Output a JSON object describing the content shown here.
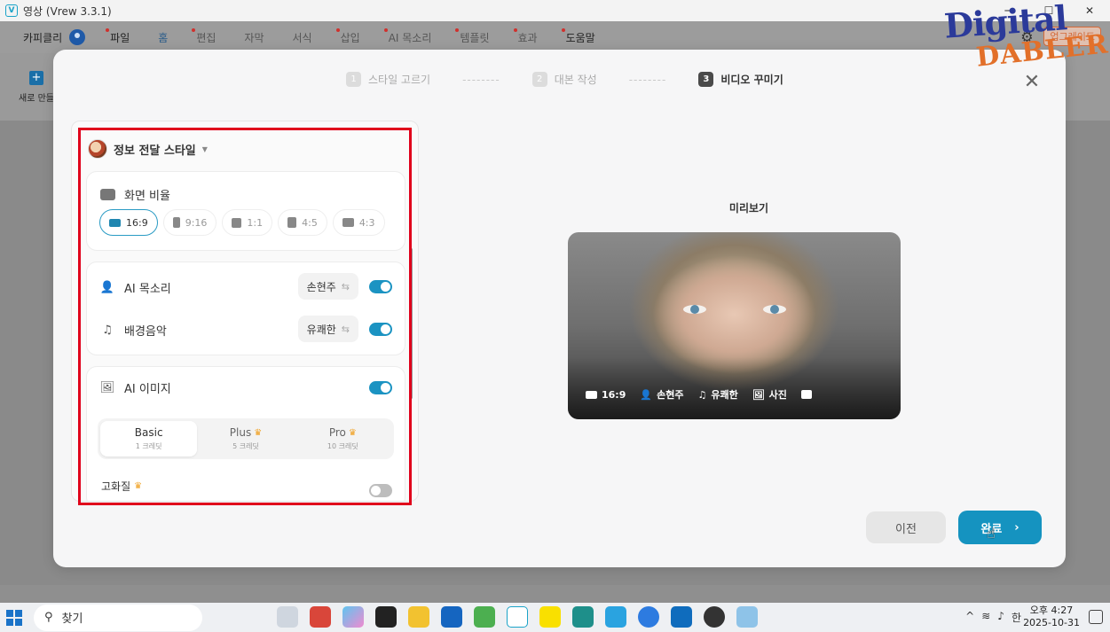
{
  "window": {
    "title": "영상 (Vrew 3.3.1)",
    "controls": [
      "─",
      "☐",
      "✕"
    ]
  },
  "menubar": {
    "user": "카피클리",
    "items": [
      "파일",
      "홈",
      "편집",
      "자막",
      "서식",
      "삽입",
      "AI 목소리",
      "템플릿",
      "효과",
      "도움말"
    ],
    "upgrade": "업그레이드"
  },
  "ribbon": {
    "new_label": "새로 만들"
  },
  "dialog": {
    "steps": [
      {
        "num": "1",
        "label": "스타일 고르기"
      },
      {
        "num": "2",
        "label": "대본 작성"
      },
      {
        "num": "3",
        "label": "비디오 꾸미기"
      }
    ],
    "step_separator": "--------",
    "style_name": "정보 전달 스타일",
    "aspect": {
      "title": "화면 비율",
      "options": [
        "16:9",
        "9:16",
        "1:1",
        "4:5",
        "4:3"
      ],
      "selected": "16:9"
    },
    "voice": {
      "label": "AI 목소리",
      "value": "손현주",
      "enabled": true
    },
    "music": {
      "label": "배경음악",
      "value": "유쾌한",
      "enabled": true
    },
    "ai_image": {
      "label": "AI 이미지",
      "enabled": true,
      "tiers": [
        {
          "name": "Basic",
          "cost": "1 크레딧",
          "premium": false
        },
        {
          "name": "Plus",
          "cost": "5 크레딧",
          "premium": true
        },
        {
          "name": "Pro",
          "cost": "10 크레딧",
          "premium": true
        }
      ],
      "selected_tier": "Basic",
      "hq_label": "고화질",
      "hq_enabled": false
    },
    "preview": {
      "title": "미리보기",
      "tags": [
        "16:9",
        "손현주",
        "유쾌한",
        "사진"
      ]
    },
    "buttons": {
      "prev": "이전",
      "done": "완료"
    }
  },
  "watermark": {
    "line1": "Digital",
    "line2": "DABLER"
  },
  "taskbar": {
    "search_placeholder": "찾기",
    "tray_lang": "한",
    "time": "오후 4:27",
    "date": "2025-10-31"
  },
  "colors": {
    "accent": "#1593c0",
    "highlight_frame": "#e0001b",
    "toggle_on": "#1b93c2"
  }
}
